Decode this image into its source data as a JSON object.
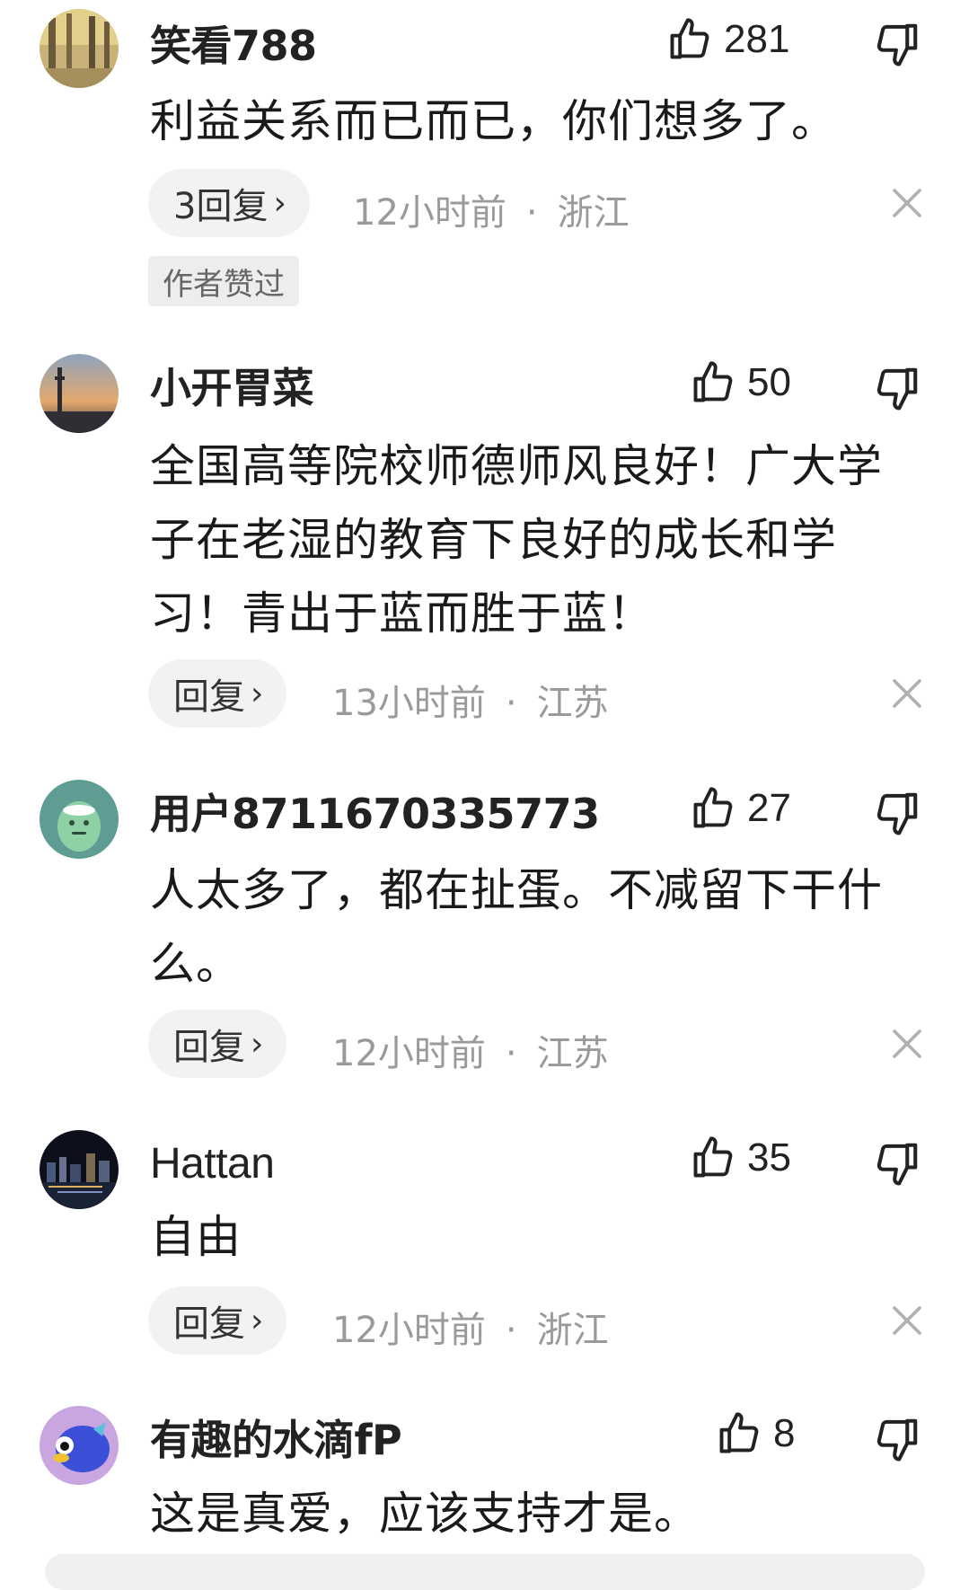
{
  "comments": [
    {
      "username": "笑看788",
      "likes": "281",
      "text": "利益关系而已而已，你们想多了。",
      "reply_label": "3回复",
      "time": "12小时前",
      "location": "浙江",
      "badge": "作者赞过"
    },
    {
      "username": "小开胃菜",
      "likes": "50",
      "text": "全国高等院校师德师风良好！广大学子在老湿的教育下良好的成长和学习！青出于蓝而胜于蓝！",
      "reply_label": "回复",
      "time": "13小时前",
      "location": "江苏"
    },
    {
      "username": "用户8711670335773",
      "likes": "27",
      "text": "人太多了，都在扯蛋。不减留下干什么。",
      "reply_label": "回复",
      "time": "12小时前",
      "location": "江苏"
    },
    {
      "username": "Hattan",
      "likes": "35",
      "text": "自由",
      "reply_label": "回复",
      "time": "12小时前",
      "location": "浙江"
    },
    {
      "username": "有趣的水滴fP",
      "likes": "8",
      "text": "这是真爱，应该支持才是。"
    }
  ],
  "separator": "·",
  "icons": {
    "like": "thumbs-up-icon",
    "dislike": "thumbs-down-icon",
    "close": "close-icon",
    "chevron": "chevron-right-icon"
  },
  "colors": {
    "text": "#222222",
    "meta": "#9a9a9a",
    "pill": "#f2f2f4"
  }
}
